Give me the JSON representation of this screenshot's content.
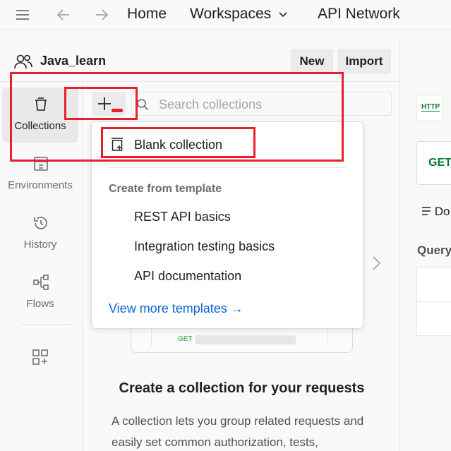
{
  "topbar": {
    "home": "Home",
    "workspaces": "Workspaces",
    "api_network": "API Network"
  },
  "workspace": {
    "name": "Java_learn",
    "new_label": "New",
    "import_label": "Import"
  },
  "rail": {
    "items": [
      {
        "label": "Collections",
        "icon": "collections-icon",
        "active": true
      },
      {
        "label": "Environments",
        "icon": "environments-icon"
      },
      {
        "label": "History",
        "icon": "history-icon"
      },
      {
        "label": "Flows",
        "icon": "flows-icon"
      }
    ]
  },
  "search": {
    "placeholder": "Search collections"
  },
  "menu": {
    "blank": "Blank collection",
    "section": "Create from template",
    "templates": [
      "REST API basics",
      "Integration testing basics",
      "API documentation"
    ],
    "more": "View more templates →"
  },
  "empty": {
    "method": "GET",
    "title": "Create a collection for your requests",
    "body": "A collection lets you group related requests and easily set common authorization, tests,"
  },
  "right_pane": {
    "http_icon": "HTTP",
    "method": "GET",
    "doc": "Do",
    "query": "Query"
  },
  "colors": {
    "accent_link": "#0c65d6",
    "annotation": "#e8202a",
    "get_green": "#077a32"
  }
}
